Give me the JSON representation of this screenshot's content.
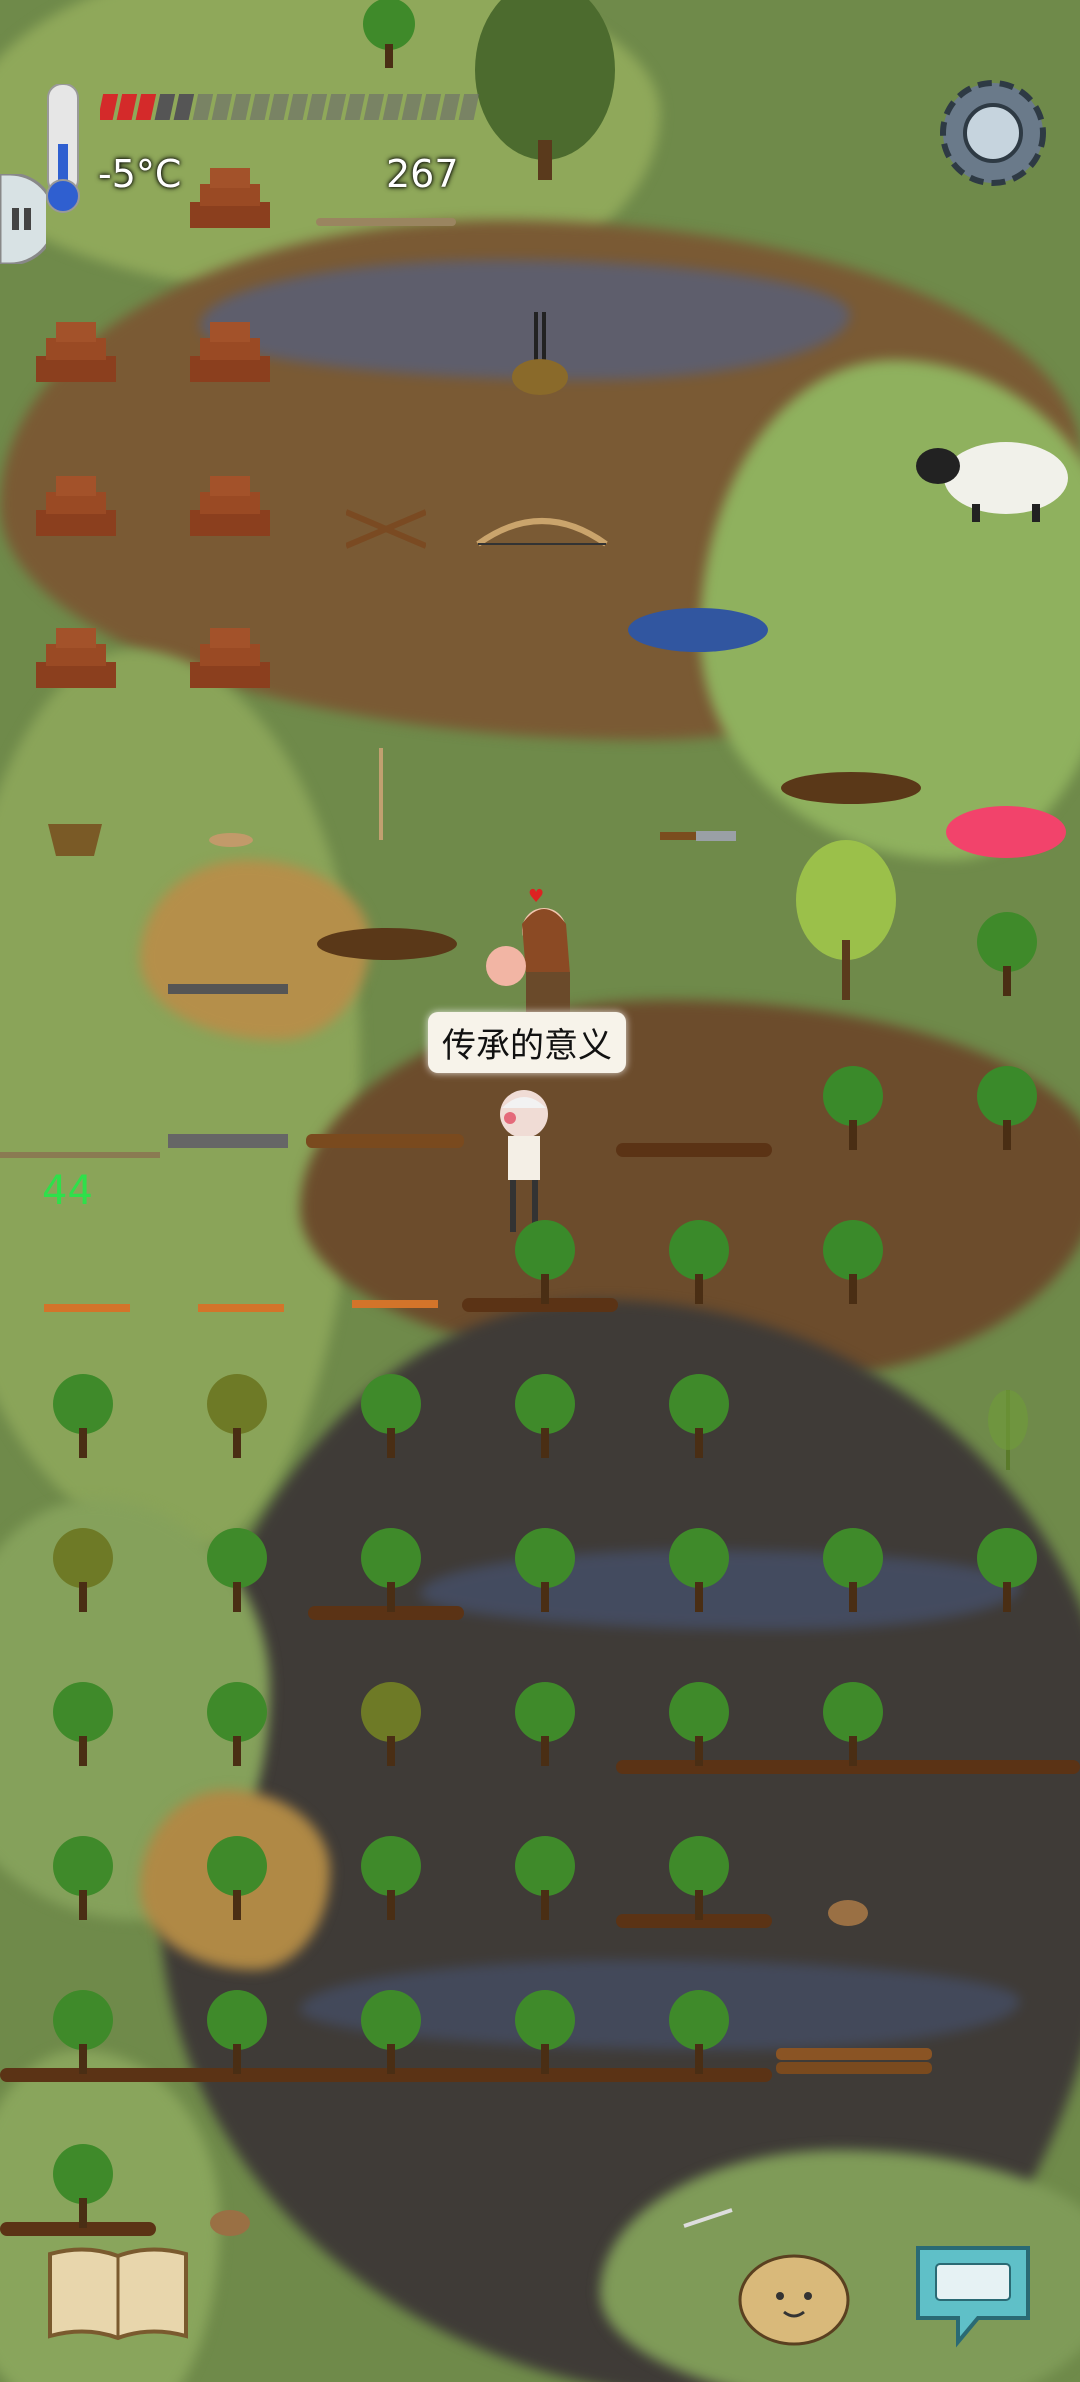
{
  "hud": {
    "temperature": "-5°C",
    "score": "267",
    "age_counter": "44"
  },
  "speech": {
    "text": "传承的意义"
  },
  "icons": {
    "settings": "gear-icon",
    "thermometer": "thermometer-icon",
    "journal": "book-icon",
    "emote": "face-icon",
    "keyboard": "keyboard-icon",
    "pause": "pause-icon"
  },
  "colors": {
    "grass": "#8fa85a",
    "dirt": "#6b4a2a",
    "dark_soil": "#3e3a36",
    "water": "#3f5b8c",
    "food_bar_red": "#d42a2a",
    "counter_green": "#2ee04a"
  },
  "food_bar": {
    "filled": 3,
    "total": 20
  }
}
